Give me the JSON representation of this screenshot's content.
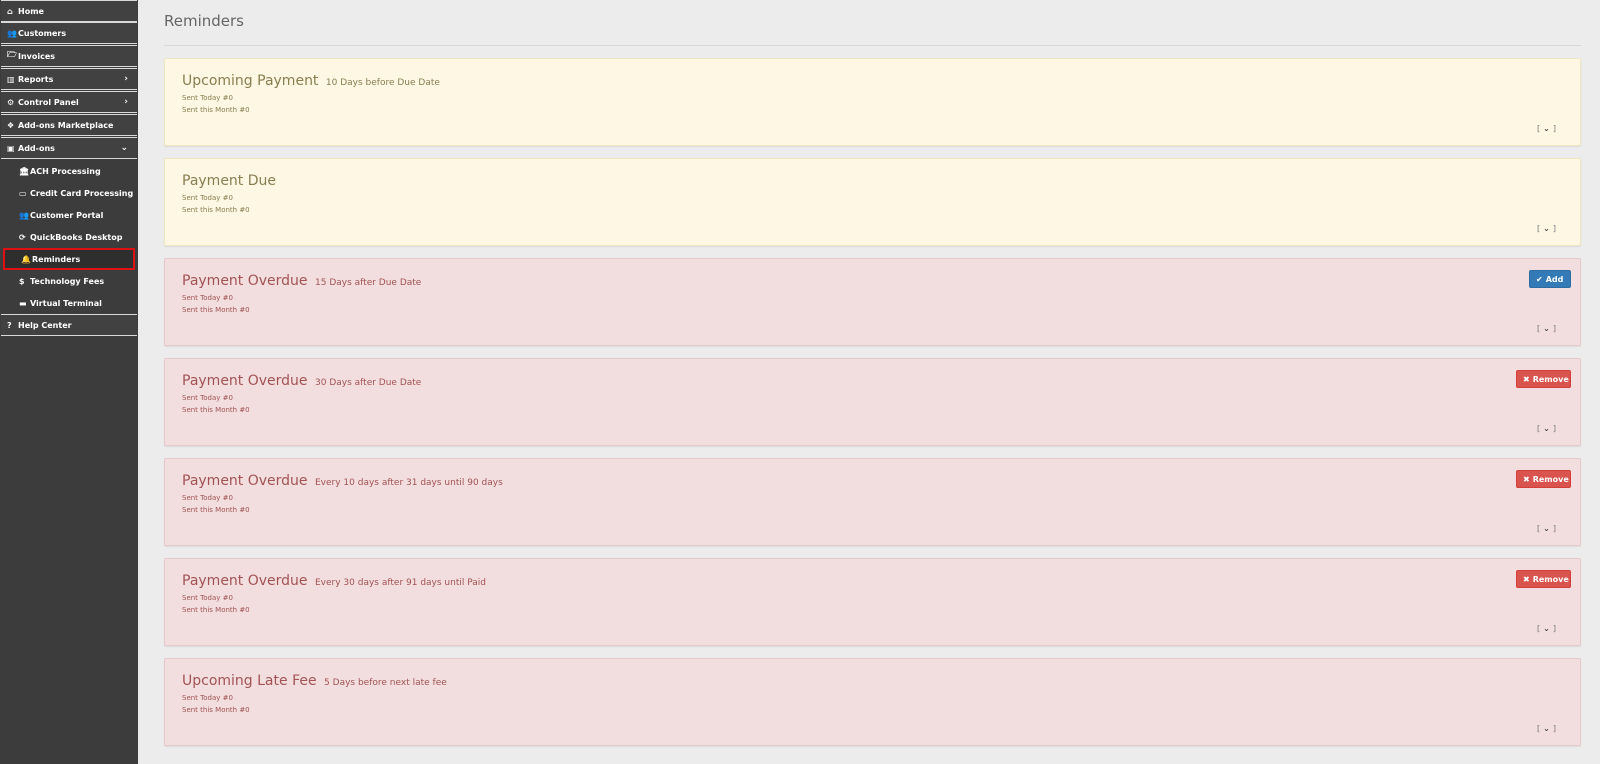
{
  "sidebar": {
    "items": [
      {
        "label": "Home",
        "icon": "home-icon",
        "glyph": "⌂"
      },
      {
        "label": "Customers",
        "icon": "users-icon",
        "glyph": "👥"
      },
      {
        "label": "Invoices",
        "icon": "folder-open-icon",
        "glyph": "🗁"
      },
      {
        "label": "Reports",
        "icon": "bar-chart-icon",
        "glyph": "▥",
        "chevron": "›"
      },
      {
        "label": "Control Panel",
        "icon": "cogs-icon",
        "glyph": "⚙",
        "chevron": "›"
      },
      {
        "label": "Add-ons Marketplace",
        "icon": "cubes-icon",
        "glyph": "❖"
      },
      {
        "label": "Add-ons",
        "icon": "object-group-icon",
        "glyph": "▣",
        "chevron": "⌄"
      }
    ],
    "addons": [
      {
        "label": "ACH Processing",
        "icon": "bank-icon",
        "glyph": "🏛"
      },
      {
        "label": "Credit Card Processing",
        "icon": "credit-card-icon",
        "glyph": "▭"
      },
      {
        "label": "Customer Portal",
        "icon": "users-icon",
        "glyph": "👥"
      },
      {
        "label": "QuickBooks Desktop",
        "icon": "refresh-icon",
        "glyph": "⟳"
      },
      {
        "label": "Reminders",
        "icon": "bell-icon",
        "glyph": "🔔"
      },
      {
        "label": "Technology Fees",
        "icon": "dollar-icon",
        "glyph": "$"
      },
      {
        "label": "Virtual Terminal",
        "icon": "credit-card-icon",
        "glyph": "▬"
      }
    ],
    "help": {
      "label": "Help Center",
      "icon": "question-circle-icon",
      "glyph": "?"
    }
  },
  "page": {
    "title": "Reminders"
  },
  "reminders": [
    {
      "title": "Upcoming Payment",
      "subtitle": "10 Days before Due Date",
      "sent_today": "Sent Today #0",
      "sent_month": "Sent this Month #0",
      "toggle": "[ ⌄ ]",
      "toggle_chev": "⌄"
    },
    {
      "title": "Payment Due",
      "subtitle": "",
      "sent_today": "Sent Today #0",
      "sent_month": "Sent this Month #0",
      "toggle_chev": "⌄"
    },
    {
      "title": "Payment Overdue",
      "subtitle": "15 Days after Due Date",
      "sent_today": "Sent Today #0",
      "sent_month": "Sent this Month #0",
      "toggle_chev": "⌄",
      "button": "Add",
      "button_icon": "✔"
    },
    {
      "title": "Payment Overdue",
      "subtitle": "30 Days after Due Date",
      "sent_today": "Sent Today #0",
      "sent_month": "Sent this Month #0",
      "toggle_chev": "⌄",
      "button": "Remove",
      "button_icon": "✖"
    },
    {
      "title": "Payment Overdue",
      "subtitle": "Every 10 days after 31 days until 90 days",
      "sent_today": "Sent Today #0",
      "sent_month": "Sent this Month #0",
      "toggle_chev": "⌄",
      "button": "Remove",
      "button_icon": "✖"
    },
    {
      "title": "Payment Overdue",
      "subtitle": "Every 30 days after 91 days until Paid",
      "sent_today": "Sent Today #0",
      "sent_month": "Sent this Month #0",
      "toggle_chev": "⌄",
      "button": "Remove",
      "button_icon": "✖"
    },
    {
      "title": "Upcoming Late Fee",
      "subtitle": "5 Days before next late fee",
      "sent_today": "Sent Today #0",
      "sent_month": "Sent this Month #0",
      "toggle_chev": "⌄"
    }
  ],
  "colors": {
    "sidebar_bg": "#3c3c3c",
    "warning_card": "#fdf7e3",
    "danger_card": "#f2dedf",
    "add_button": "#337ab7",
    "remove_button": "#d9534f",
    "active_outline": "#dd1111"
  }
}
